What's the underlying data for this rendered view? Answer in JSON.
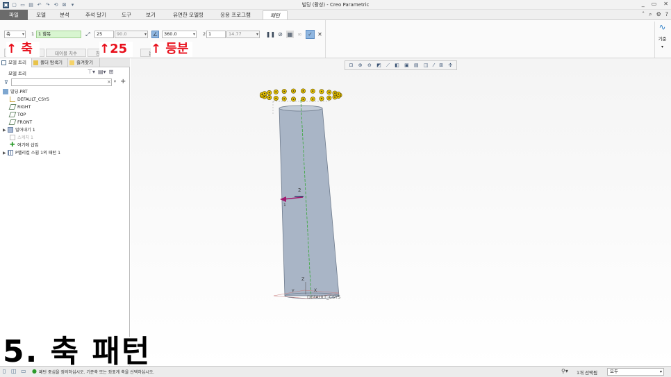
{
  "window": {
    "title": "빌딩 (활성) - Creo Parametric",
    "controls": [
      "_",
      "▭",
      "✕"
    ]
  },
  "ribbon": {
    "tabs": [
      {
        "label": "파일"
      },
      {
        "label": "모델"
      },
      {
        "label": "분석"
      },
      {
        "label": "주석 달기"
      },
      {
        "label": "도구"
      },
      {
        "label": "보기"
      },
      {
        "label": "유연한 모델링"
      },
      {
        "label": "응용 프로그램"
      },
      {
        "label": "패턴"
      }
    ],
    "active_tab": "패턴"
  },
  "dashboard": {
    "pattern_type": "축",
    "axis_ref": "1 항목",
    "first_count": "25",
    "first_angle": "90.0",
    "angular_extent": "360.0",
    "second_label": "2",
    "second_count": "1",
    "second_spacing": "14.77",
    "subtabs": [
      "치수",
      "테이블 치수",
      "참조",
      "옵션",
      "속성"
    ],
    "annotations": [
      "↑ 축",
      "↑25",
      "↑ 등분"
    ]
  },
  "datum": {
    "label": "기준"
  },
  "navigator": {
    "tabs": [
      "모델 트리",
      "폴더 탐색기",
      "즐겨찾기"
    ],
    "tree_header": "모델 트리",
    "tree": [
      {
        "label": "빌딩.PRT",
        "icon": "part-icon"
      },
      {
        "label": "DEFAULT_CSYS",
        "icon": "csys-icon"
      },
      {
        "label": "RIGHT",
        "icon": "plane-icon"
      },
      {
        "label": "TOP",
        "icon": "plane-icon"
      },
      {
        "label": "FRONT",
        "icon": "plane-icon"
      },
      {
        "label": "밀어내기 1",
        "icon": "extrude-icon"
      },
      {
        "label": "스케치 1",
        "icon": "sketch-icon"
      },
      {
        "label": "여기에 삽입",
        "icon": "insert-icon"
      },
      {
        "label": "P헬리컬 스윕 1의 패턴 1",
        "icon": "pattern-icon"
      }
    ]
  },
  "graphics": {
    "csys_label": "DEFAULT_CSYS",
    "axis_labels": [
      "Z",
      "Y",
      "X",
      "1",
      "2"
    ]
  },
  "status": {
    "message": "패턴 중심을 정의하십시오. 기준축 또는 좌표계 축을 선택하십시오.",
    "selection": "1개 선택됨",
    "filter": "모두"
  },
  "caption": "5. 축 패턴",
  "colors": {
    "accent_red": "#e8101c",
    "file_tab": "#6b6b6b",
    "cylinder": "#a9b5c6",
    "pattern_dot": "#e5c100"
  }
}
